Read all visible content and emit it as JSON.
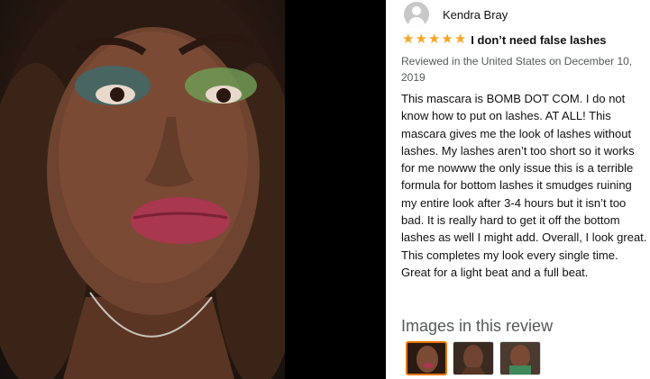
{
  "review": {
    "reviewer_name": "Kendra Bray",
    "avatar_icon": "user-silhouette-icon",
    "rating": 5,
    "rating_max": 5,
    "star_icon": "star-icon",
    "star_color": "#f5a623",
    "title": "I don’t need false lashes",
    "date": "Reviewed in the United States on December 10, 2019",
    "body": "This mascara is BOMB DOT COM. I do not know how to put on lashes. AT ALL! This mascara gives me the look of lashes without lashes. My lashes aren’t too short so it works for me nowww the only issue this is a terrible formula for bottom lashes it smudges ruining my entire look after 3-4 hours but it isn’t too bad. It is really hard to get it off the bottom lashes as well I might add. Overall, I look great. This completes my look every single time. Great for a light beat and a full beat."
  },
  "images": {
    "heading": "Images in this review",
    "selected_index": 0,
    "selected_border_color": "#e77600",
    "thumbnails": [
      "review-image-1",
      "review-image-2",
      "review-image-3"
    ]
  }
}
